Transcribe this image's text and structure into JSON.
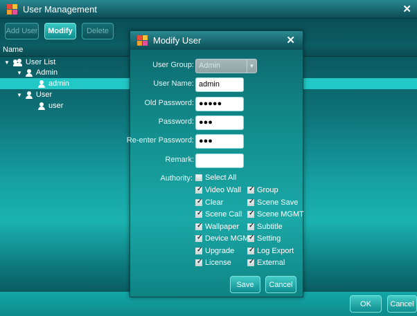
{
  "window": {
    "title": "User Management"
  },
  "toolbar": {
    "add_user": "Add User",
    "modify": "Modify",
    "delete": "Delete"
  },
  "list": {
    "header": "Name"
  },
  "tree": {
    "root": "User List",
    "groups": [
      {
        "name": "Admin",
        "users": [
          "admin"
        ]
      },
      {
        "name": "User",
        "users": [
          "user"
        ]
      }
    ]
  },
  "footer": {
    "ok": "OK",
    "cancel": "Cancel"
  },
  "dialog": {
    "title": "Modify User",
    "fields": {
      "user_group": {
        "label": "User Group:",
        "value": "Admin"
      },
      "user_name": {
        "label": "User Name:",
        "value": "admin"
      },
      "old_password": {
        "label": "Old Password:",
        "value": "●●●●●"
      },
      "password": {
        "label": "Password:",
        "value": "●●●"
      },
      "reenter_password": {
        "label": "Re-enter Password:",
        "value": "●●●"
      },
      "remark": {
        "label": "Remark:",
        "value": ""
      }
    },
    "authority": {
      "label": "Authority:",
      "select_all": {
        "label": "Select All",
        "checked": false
      },
      "left": [
        {
          "label": "Video Wall",
          "checked": true
        },
        {
          "label": "Clear",
          "checked": true
        },
        {
          "label": "Scene Call",
          "checked": true
        },
        {
          "label": "Wallpaper",
          "checked": true
        },
        {
          "label": "Device MGMT",
          "checked": true
        },
        {
          "label": "Upgrade",
          "checked": true
        },
        {
          "label": "License",
          "checked": true
        }
      ],
      "right": [
        {
          "label": "Group",
          "checked": true
        },
        {
          "label": "Scene Save",
          "checked": true
        },
        {
          "label": "Scene MGMT",
          "checked": true
        },
        {
          "label": "Subtitle",
          "checked": true
        },
        {
          "label": "Setting",
          "checked": true
        },
        {
          "label": "Log Export",
          "checked": true
        },
        {
          "label": "External",
          "checked": true
        }
      ]
    },
    "save": "Save",
    "cancel": "Cancel"
  },
  "icons": {
    "app": "app-logo-icon",
    "close": "close-icon",
    "user": "user-icon",
    "group": "users-group-icon",
    "expand": "triangle-down-icon"
  }
}
